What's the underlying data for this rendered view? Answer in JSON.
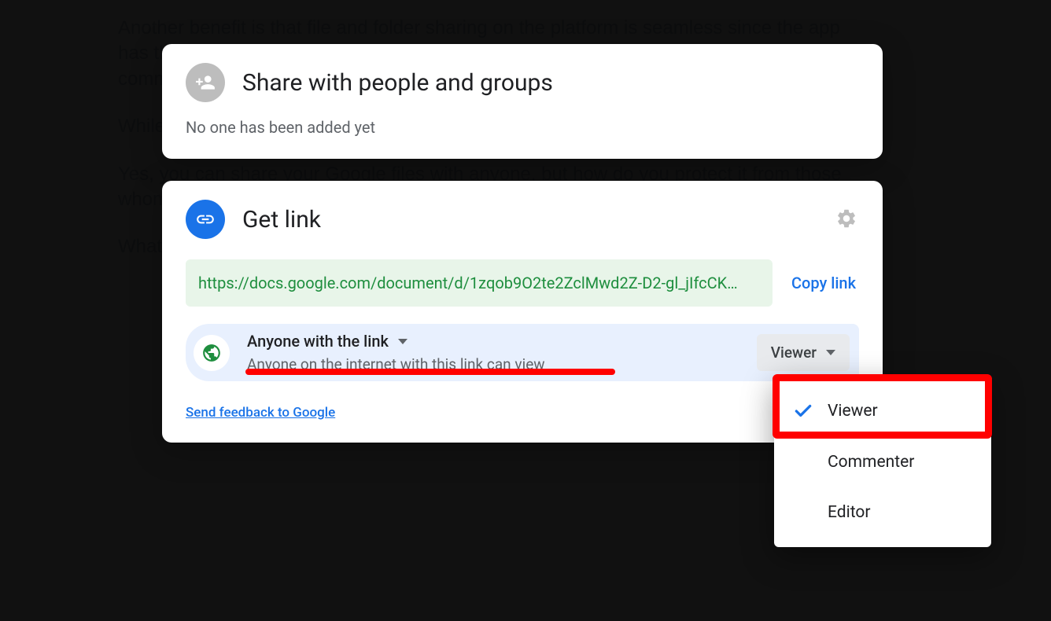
{
  "background": {
    "paragraph1": "Another benefit is that file and folder sharing on the platform is seamless since the app has this fantastic ability to share with others. You can allow the person to view, comment, or edit the file by",
    "paragraph2": "While drawb",
    "paragraph3": "Yes, you can share your Google files with anyone, but how do you protect it from those whom you de",
    "paragraph4": "What"
  },
  "share": {
    "title": "Share with people and groups",
    "subtitle": "No one has been added yet"
  },
  "link": {
    "title": "Get link",
    "url": "https://docs.google.com/document/d/1zqob9O2te2ZclMwd2Z-D2-gl_jIfcCK…",
    "copy_label": "Copy link",
    "access_label": "Anyone with the link",
    "access_desc": "Anyone on the internet with this link can view",
    "role_button": "Viewer",
    "feedback": "Send feedback to Google"
  },
  "dropdown": {
    "items": [
      {
        "label": "Viewer",
        "selected": true
      },
      {
        "label": "Commenter",
        "selected": false
      },
      {
        "label": "Editor",
        "selected": false
      }
    ]
  },
  "icons": {
    "person_add": "person-add-icon",
    "link": "link-icon",
    "gear": "gear-icon",
    "globe": "globe-icon",
    "check": "check-icon"
  }
}
